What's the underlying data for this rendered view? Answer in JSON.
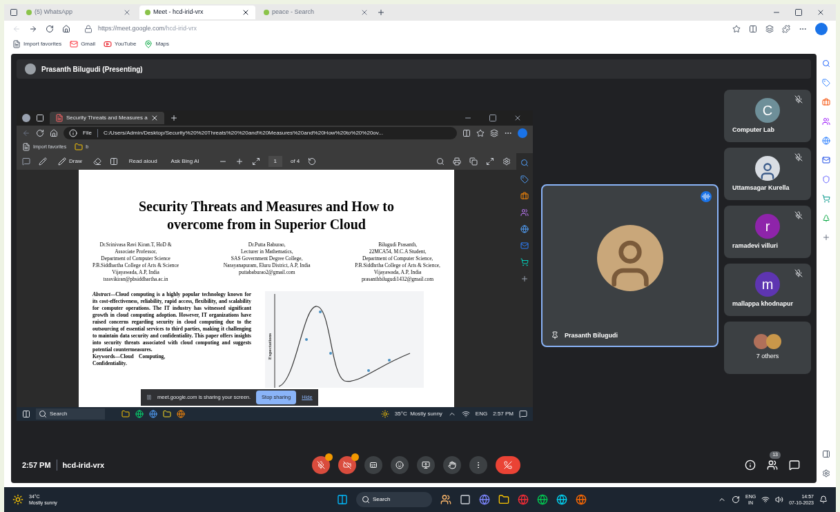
{
  "browser": {
    "tabs": [
      {
        "title": "(5) WhatsApp",
        "selected": false
      },
      {
        "title": "Meet - hcd-irid-vrx",
        "selected": true
      },
      {
        "title": "peace - Search",
        "selected": false
      }
    ],
    "url_host": "https://meet.google.com",
    "url_path": "/hcd-irid-vrx",
    "favorites": [
      {
        "kind": "import",
        "label": "Import favorites"
      },
      {
        "kind": "gmail",
        "label": "Gmail"
      },
      {
        "kind": "youtube",
        "label": "YouTube"
      },
      {
        "kind": "maps",
        "label": "Maps"
      }
    ]
  },
  "meet": {
    "presenter_banner": "Prasanth Bilugudi (Presenting)",
    "shared_screen": {
      "tab": "Security Threats and Measures a",
      "file_label": "File",
      "url": "C:/Users/Admin/Desktop/Security%20%20Threats%20%20and%20Measures%20and%20How%20to%20%20ov...",
      "favorites": [
        {
          "kind": "import",
          "label": "Import favorites"
        },
        {
          "kind": "folder",
          "label": "b"
        }
      ],
      "toolbar": {
        "draw": "Draw",
        "read_aloud": "Read aloud",
        "ask": "Ask Bing AI",
        "page": "1",
        "page_count": "of 4"
      },
      "document": {
        "title": "Security Threats and Measures and How to overcome from in Superior Cloud",
        "authors": [
          [
            "Dr.Srinivasa Ravi Kiran.T, HoD &",
            "Associate Professor,",
            "Department of Computer Science",
            "P.B.Siddhartha College of Arts & Science",
            "Vijayawada, A.P,  India",
            "tsravikiran@pbsiddhartha.ac.in"
          ],
          [
            "Dr.Putta Baburao,",
            "Lecturer in Mathematics,",
            "SAS Government Degree College,",
            "Narayanapuram, Eluru District, A.P, India",
            "puttababurao2@gmail.com"
          ],
          [
            "Bilugudi Prasanth,",
            "22MCA54, M.C.A Student,",
            "Department of Computer Science,",
            "P.B.Siddhrtha College of Arts & Science,",
            "Vijayawada, A.P, India",
            "prasanthbilugudi1432@gmail.com"
          ]
        ],
        "abstract": "*Abstract*—Cloud computing is a highly popular technology known for its cost-effectiveness, reliability, rapid access, flexibility, and scalability for computer operations. The IT industry has witnessed significant growth in cloud computing adoption. However, IT organizations have raised concerns regarding security in cloud computing due to the outsourcing of essential services to third parties, making it challenging to maintain data security and confidentiality. This paper offers insights into security threats associated with cloud computing and suggests potential countermeasures.",
        "keywords": "Keywords—Cloud    Computing,",
        "keywords_end": "Confidentiality.",
        "figure_ylabel": "Expectations"
      },
      "share_notice": {
        "text": "meet.google.com is sharing your screen.",
        "stop": "Stop sharing",
        "hide": "Hide"
      },
      "taskbar": {
        "search": "Search",
        "weather": "35°C  Mostly sunny",
        "lang": "ENG",
        "time": "2:57 PM"
      }
    },
    "main_tile": {
      "name": "Prasanth Bilugudi",
      "speaking": true
    },
    "participants": [
      {
        "kind": "initial",
        "name": "Computer Lab",
        "initial": "C",
        "color": "#6e8f99",
        "muted": true
      },
      {
        "kind": "photo",
        "name": "Uttamsagar Kurella",
        "muted": true
      },
      {
        "kind": "initial",
        "name": "ramadevi villuri",
        "initial": "r",
        "color": "#8e24aa",
        "muted": true
      },
      {
        "kind": "initial",
        "name": "mallappa khodnapur",
        "initial": "m",
        "color": "#5e35b1",
        "muted": true
      }
    ],
    "others": "7 others",
    "bottom": {
      "time": "2:57 PM",
      "code": "hcd-irid-vrx",
      "people_count": "13",
      "controls": [
        {
          "kind": "mic",
          "on": false
        },
        {
          "kind": "camera",
          "on": false
        },
        {
          "kind": "captions"
        },
        {
          "kind": "emoji"
        },
        {
          "kind": "present"
        },
        {
          "kind": "hand"
        },
        {
          "kind": "more"
        },
        {
          "kind": "leave"
        }
      ]
    }
  },
  "taskbar": {
    "weather_temp": "34°C",
    "weather_text": "Mostly sunny",
    "search": "Search",
    "lang": "ENG",
    "region": "IN",
    "time": "14:57",
    "date": "07-10-2023"
  }
}
